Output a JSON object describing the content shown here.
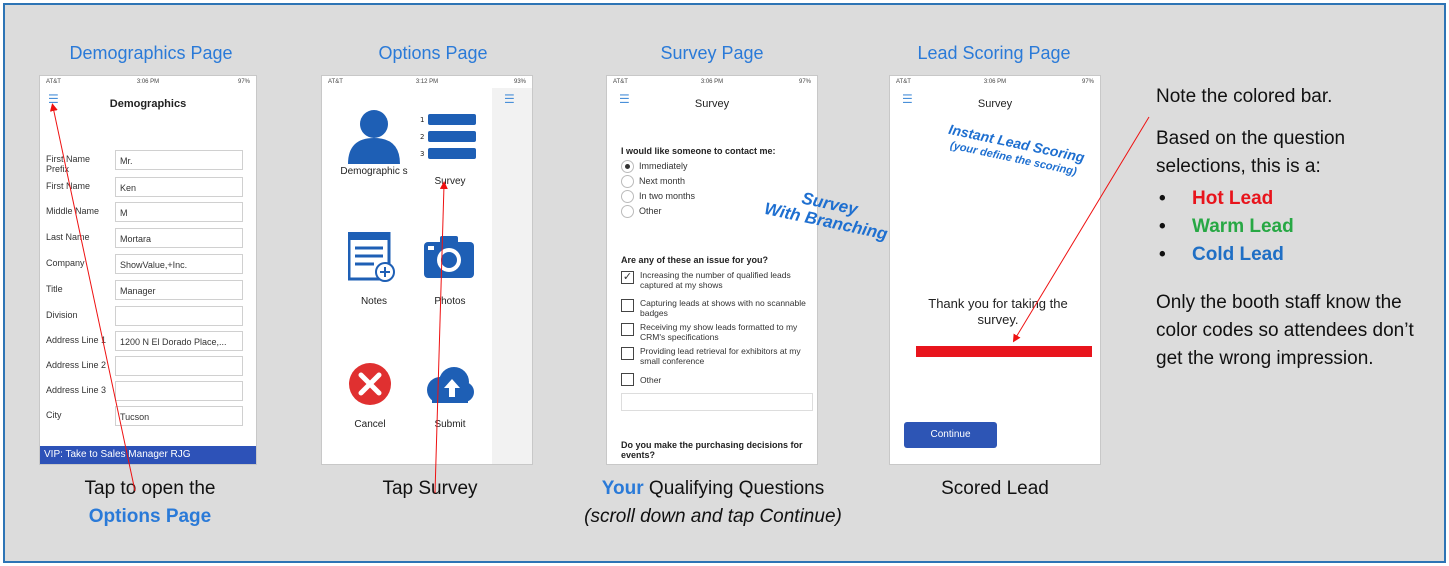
{
  "titles": {
    "demographics": "Demographics Page",
    "options": "Options Page",
    "survey": "Survey Page",
    "lead_scoring": "Lead Scoring Page"
  },
  "status_bar": {
    "carrier": "AT&T",
    "time_demo": "3:06 PM",
    "time_options": "3:12 PM",
    "battery_demo": "97%",
    "battery_options": "93%"
  },
  "demographics": {
    "nav_title": "Demographics",
    "rows": [
      {
        "label": "First Name Prefix",
        "value": "Mr."
      },
      {
        "label": "First Name",
        "value": "Ken"
      },
      {
        "label": "Middle Name",
        "value": "M"
      },
      {
        "label": "Last Name",
        "value": "Mortara"
      },
      {
        "label": "Company",
        "value": "ShowValue,+Inc."
      },
      {
        "label": "Title",
        "value": "Manager"
      },
      {
        "label": "Division",
        "value": ""
      },
      {
        "label": "Address Line 1",
        "value": "1200 N El Dorado Place,..."
      },
      {
        "label": "Address Line 2",
        "value": ""
      },
      {
        "label": "Address Line 3",
        "value": ""
      },
      {
        "label": "City",
        "value": "Tucson"
      }
    ],
    "vip_banner": "VIP: Take to Sales Manager RJG"
  },
  "options": {
    "demographics": "Demographic s",
    "survey": "Survey",
    "notes": "Notes",
    "photos": "Photos",
    "cancel": "Cancel",
    "submit": "Submit"
  },
  "survey": {
    "nav_title": "Survey",
    "q1": "I would like someone to contact me:",
    "q1_options": [
      "Immediately",
      "Next month",
      "In two months",
      "Other"
    ],
    "q2": "Are any of these an issue for you?",
    "q2_options": [
      "Increasing the number of qualified leads captured at my shows",
      "Capturing leads at shows with no scannable badges",
      "Receiving my show leads formatted to my CRM's specifications",
      "Providing lead retrieval for exhibitors at my small conference",
      "Other"
    ],
    "q3": "Do you make the purchasing decisions for events?",
    "overlay_line1": "Survey",
    "overlay_line2": "With Branching"
  },
  "lead": {
    "nav_title": "Survey",
    "overlay_line1": "Instant Lead Scoring",
    "overlay_line2": "(your define the scoring)",
    "thanks": "Thank you for taking the survey.",
    "bar_color": "#e8141c",
    "continue": "Continue"
  },
  "captions": {
    "demo_line1": "Tap to open the",
    "demo_line2": "Options Page",
    "options": "Tap Survey",
    "survey_your": "Your",
    "survey_rest": " Qualifying Questions",
    "survey_line2": "(scroll down and tap Continue)",
    "lead": "Scored Lead"
  },
  "notes": {
    "p1": "Note the colored bar.",
    "p2": "Based on the question selections, this is a:",
    "leads": [
      {
        "label": "Hot Lead",
        "color": "#e8141c"
      },
      {
        "label": "Warm Lead",
        "color": "#27a844"
      },
      {
        "label": "Cold Lead",
        "color": "#1f6fc5"
      }
    ],
    "p3": "Only the booth staff know the color codes so attendees don’t get the wrong impression."
  }
}
